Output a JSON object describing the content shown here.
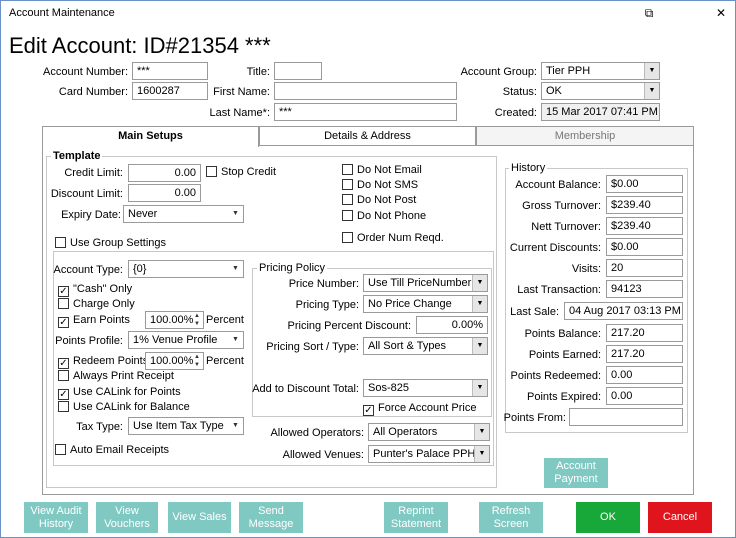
{
  "window": {
    "title": "Account Maintenance",
    "restore_glyph": "⧉",
    "close_glyph": "✕"
  },
  "header": {
    "page_title": "Edit Account: ID#21354 ***",
    "account_number_label": "Account Number:",
    "account_number": "***",
    "card_number_label": "Card Number:",
    "card_number": "1600287",
    "title_label": "Title:",
    "title_value": "",
    "first_name_label": "First Name:",
    "first_name": "",
    "last_name_label": "Last Name*:",
    "last_name": "***",
    "account_group_label": "Account Group:",
    "account_group": "Tier PPH",
    "status_label": "Status:",
    "status": "OK",
    "created_label": "Created:",
    "created": "15 Mar 2017 07:41 PM"
  },
  "tabs": [
    {
      "label": "Main Setups",
      "active": true
    },
    {
      "label": "Details & Address",
      "active": false
    },
    {
      "label": "Membership",
      "active": false
    }
  ],
  "template": {
    "title": "Template",
    "credit_limit_label": "Credit Limit:",
    "credit_limit": "0.00",
    "stop_credit_label": "Stop Credit",
    "discount_limit_label": "Discount Limit:",
    "discount_limit": "0.00",
    "expiry_date_label": "Expiry Date:",
    "expiry_date": "Never",
    "do_not_email": "Do Not Email",
    "do_not_sms": "Do Not SMS",
    "do_not_post": "Do Not Post",
    "do_not_phone": "Do Not Phone",
    "order_num_reqd": "Order Num Reqd.",
    "use_group_settings": "Use Group Settings"
  },
  "account": {
    "account_type_label": "Account Type:",
    "account_type": "{0}",
    "cash_only": "\"Cash\" Only",
    "charge_only": "Charge Only",
    "earn_points": "Earn Points",
    "earn_points_value": "100.00%",
    "percent_label": "Percent",
    "points_profile_label": "Points Profile:",
    "points_profile": "1% Venue Profile",
    "redeem_points": "Redeem Points",
    "redeem_points_value": "100.00%",
    "always_print_receipt": "Always Print Receipt",
    "use_calink_points": "Use CALink for Points",
    "use_calink_balance": "Use CALink for Balance",
    "tax_type_label": "Tax Type:",
    "tax_type": "Use Item Tax Type",
    "auto_email_receipts": "Auto Email Receipts"
  },
  "pricing": {
    "title": "Pricing Policy",
    "price_number_label": "Price Number:",
    "price_number": "Use Till PriceNumber",
    "pricing_type_label": "Pricing Type:",
    "pricing_type": "No Price Change",
    "pricing_percent_label": "Pricing Percent Discount:",
    "pricing_percent": "0.00%",
    "pricing_sort_label": "Pricing Sort / Type:",
    "pricing_sort": "All Sort & Types",
    "add_discount_label": "Add to Discount Total:",
    "add_discount": "Sos-825",
    "force_account_price": "Force Account Price",
    "allowed_operators_label": "Allowed Operators:",
    "allowed_operators": "All Operators",
    "allowed_venues_label": "Allowed Venues:",
    "allowed_venues": "Punter's Palace PPH"
  },
  "history": {
    "title": "History",
    "account_balance_label": "Account Balance:",
    "account_balance": "$0.00",
    "gross_turnover_label": "Gross Turnover:",
    "gross_turnover": "$239.40",
    "nett_turnover_label": "Nett Turnover:",
    "nett_turnover": "$239.40",
    "current_discounts_label": "Current Discounts:",
    "current_discounts": "$0.00",
    "visits_label": "Visits:",
    "visits": "20",
    "last_transaction_label": "Last Transaction:",
    "last_transaction": "94123",
    "last_sale_label": "Last Sale:",
    "last_sale": "04 Aug 2017 03:13 PM",
    "points_balance_label": "Points Balance:",
    "points_balance": "217.20",
    "points_earned_label": "Points Earned:",
    "points_earned": "217.20",
    "points_redeemed_label": "Points Redeemed:",
    "points_redeemed": "0.00",
    "points_expired_label": "Points Expired:",
    "points_expired": "0.00",
    "points_from_label": "Points From:",
    "points_from": ""
  },
  "account_payment": {
    "line1": "Account",
    "line2": "Payment"
  },
  "footer": {
    "view_audit": {
      "line1": "View Audit",
      "line2": "History"
    },
    "view_vouchers": {
      "line1": "View",
      "line2": "Vouchers"
    },
    "view_sales": "View Sales",
    "send_message": {
      "line1": "Send",
      "line2": "Message"
    },
    "reprint": {
      "line1": "Reprint",
      "line2": "Statement"
    },
    "refresh": {
      "line1": "Refresh",
      "line2": "Screen"
    },
    "ok": "OK",
    "cancel": "Cancel"
  },
  "check_glyph": "✓",
  "arrow_glyph": "▼",
  "spin_up_glyph": "▲",
  "spin_down_glyph": "▼",
  "colors": {
    "teal_button": "#80c9c3",
    "ok_green": "#18a83a",
    "cancel_red": "#e0141c",
    "border_blue": "#6b8fc7"
  }
}
